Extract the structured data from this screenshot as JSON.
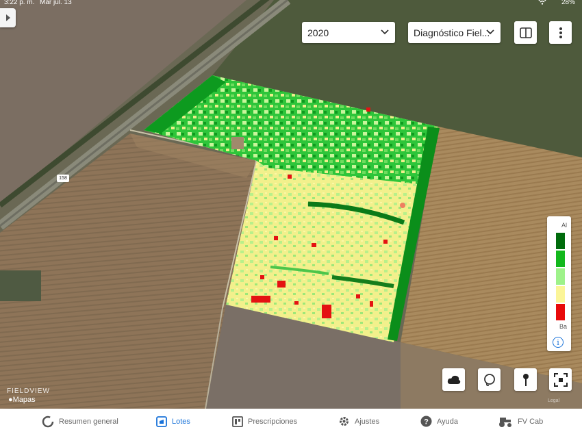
{
  "status_bar": {
    "time": "3:22 p. m.",
    "date": "Mar jul. 13",
    "battery": "28%"
  },
  "toolbar": {
    "year_dropdown": "2020",
    "layer_dropdown": "Diagnóstico Fiel...",
    "split_view_icon": "split-view-icon",
    "more_icon": "more-vertical-icon"
  },
  "legend": {
    "high_label": "Al",
    "low_label": "Ba",
    "colors": [
      "#006b0c",
      "#12b81c",
      "#9ef28a",
      "#fbf598",
      "#e80a0a"
    ]
  },
  "map": {
    "road_label": "158",
    "brand": "FIELDVIEW",
    "attribution": "Mapas",
    "legal": "Legal"
  },
  "map_tools": [
    "cloud-icon",
    "lasso-icon",
    "pin-icon",
    "focus-icon"
  ],
  "tabs": [
    {
      "label": "Resumen general",
      "icon": "summary-ring-icon",
      "active": false
    },
    {
      "label": "Lotes",
      "icon": "fields-icon",
      "active": true
    },
    {
      "label": "Prescripciones",
      "icon": "prescriptions-icon",
      "active": false
    },
    {
      "label": "Ajustes",
      "icon": "gear-icon",
      "active": false
    },
    {
      "label": "Ayuda",
      "icon": "help-icon",
      "active": false
    },
    {
      "label": "FV Cab",
      "icon": "tractor-icon",
      "active": false
    }
  ]
}
